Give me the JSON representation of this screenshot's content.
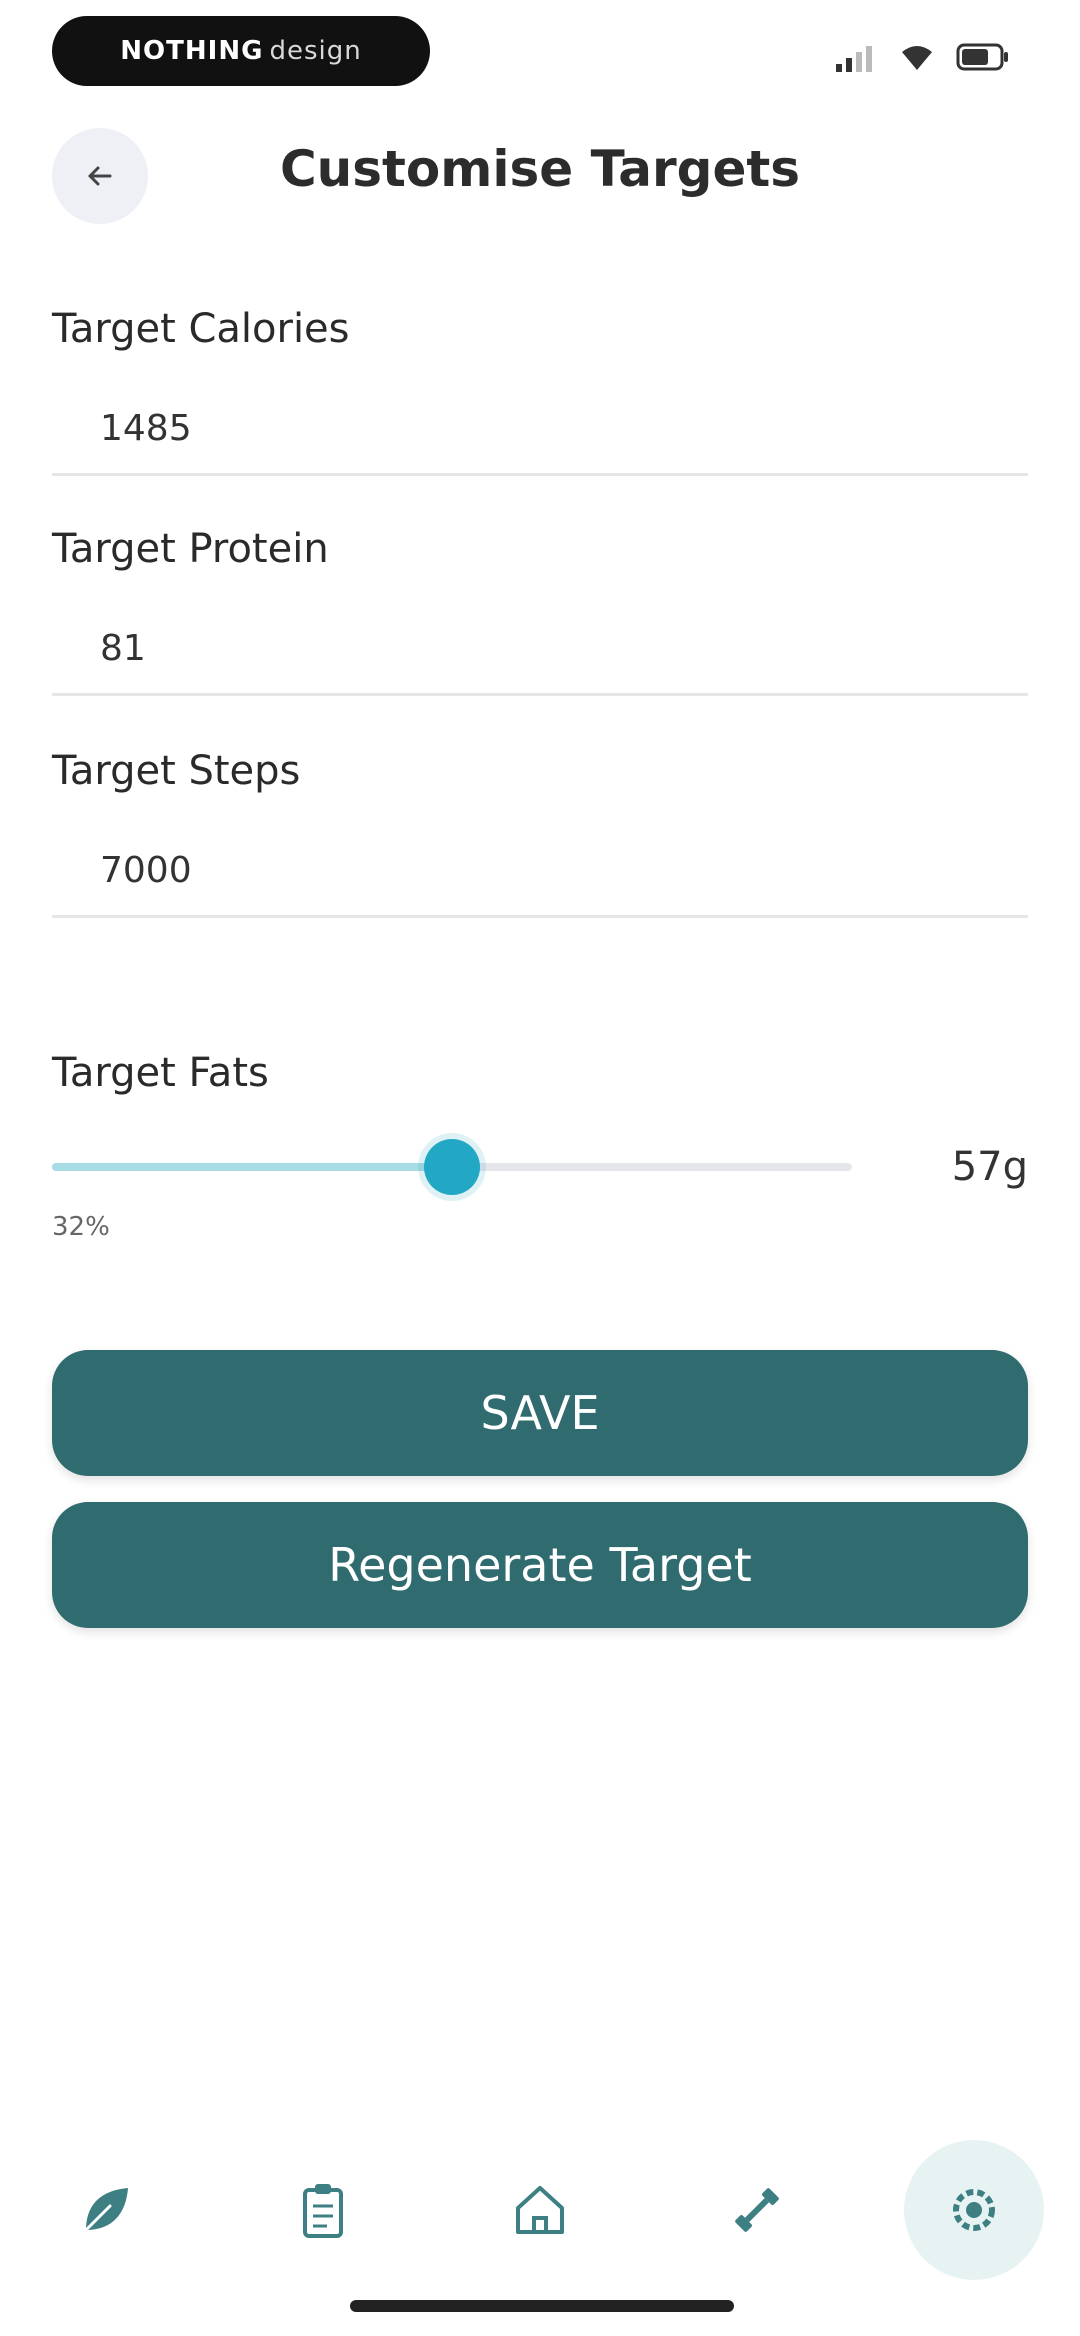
{
  "status_bar": {
    "pill_left": "NOTHING",
    "pill_right": "design"
  },
  "header": {
    "title": "Customise Targets",
    "back_icon": "back-arrow-icon"
  },
  "fields": {
    "calories": {
      "label": "Target Calories",
      "value": "1485"
    },
    "protein": {
      "label": "Target Protein",
      "value": "81"
    },
    "steps": {
      "label": "Target Steps",
      "value": "7000"
    }
  },
  "fats": {
    "label": "Target Fats",
    "value_text": "57g",
    "percent_text": "32%",
    "slider_fraction": 0.5
  },
  "buttons": {
    "save": "SAVE",
    "regenerate": "Regenerate Target"
  },
  "bottom_nav": {
    "items": [
      {
        "icon": "leaf-icon"
      },
      {
        "icon": "clipboard-icon"
      },
      {
        "icon": "home-icon"
      },
      {
        "icon": "dumbbell-icon"
      },
      {
        "icon": "settings-icon",
        "active": true
      }
    ]
  },
  "colors": {
    "accent": "#2f6b6f",
    "slider": "#22a8c4",
    "nav_icon": "#3d7f82"
  }
}
